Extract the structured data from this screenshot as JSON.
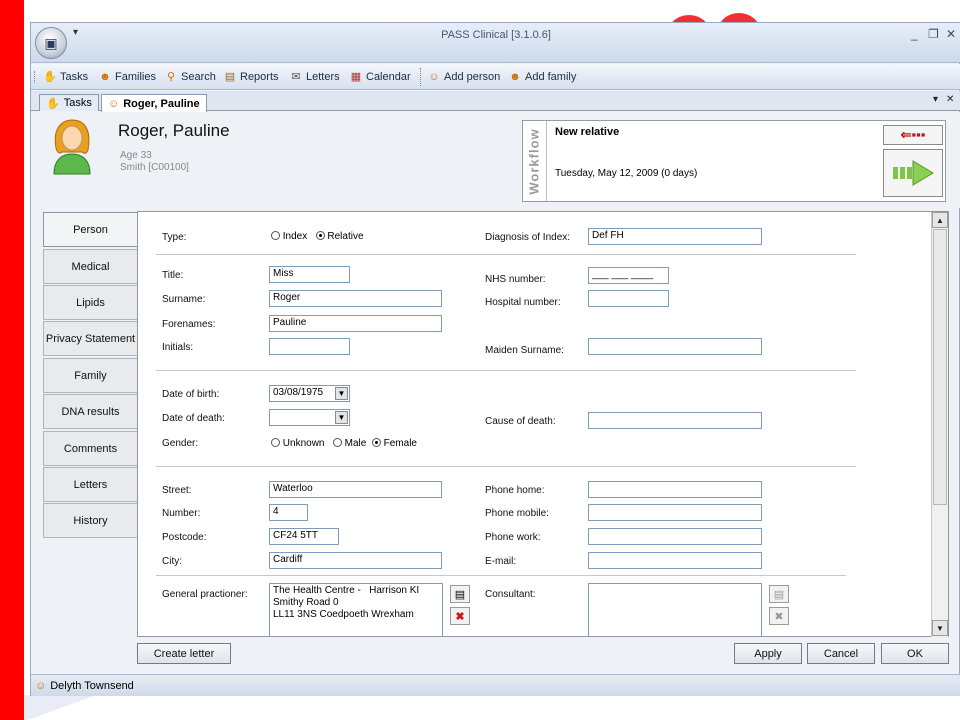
{
  "window": {
    "title": "PASS Clinical [3.1.0.6]",
    "qat_glyph": "▾",
    "min_glyph": "_",
    "restore_glyph": "❐",
    "close_glyph": "✕"
  },
  "toolbar": {
    "items": [
      {
        "label": "Tasks",
        "icon": "hand-icon"
      },
      {
        "label": "Families",
        "icon": "families-icon"
      },
      {
        "label": "Search",
        "icon": "search-icon"
      },
      {
        "label": "Reports",
        "icon": "reports-icon"
      },
      {
        "label": "Letters",
        "icon": "letters-icon"
      },
      {
        "label": "Calendar",
        "icon": "calendar-icon"
      }
    ],
    "add_items": [
      {
        "label": "Add person",
        "icon": "add-person-icon"
      },
      {
        "label": "Add family",
        "icon": "add-family-icon"
      }
    ]
  },
  "tabs": [
    {
      "label": "Tasks",
      "active": false
    },
    {
      "label": "Roger, Pauline",
      "active": true
    }
  ],
  "tab_controls": {
    "dropdown": "▾",
    "close": "✕"
  },
  "patient": {
    "name": "Roger, Pauline",
    "age": "Age 33",
    "family": "Smith [C00100]"
  },
  "workflow": {
    "label": "Workflow",
    "step": "New relative",
    "date": "Tuesday, May 12, 2009 (0 days)",
    "back_glyph": "⇐▪▪▪"
  },
  "nav": {
    "items": [
      "Person",
      "Medical",
      "Lipids",
      "Privacy Statement",
      "Family",
      "DNA results",
      "Comments",
      "Letters",
      "History"
    ],
    "active": "Person"
  },
  "form": {
    "type": {
      "label": "Type:",
      "options": [
        "Index",
        "Relative"
      ],
      "selected": "Relative"
    },
    "diagnosis": {
      "label": "Diagnosis of Index:",
      "value": "Def FH"
    },
    "title": {
      "label": "Title:",
      "value": "Miss"
    },
    "surname": {
      "label": "Surname:",
      "value": "Roger"
    },
    "forenames": {
      "label": "Forenames:",
      "value": "Pauline"
    },
    "initials": {
      "label": "Initials:",
      "value": ""
    },
    "nhs_number": {
      "label": "NHS number:",
      "value": "___ ___ ____"
    },
    "hospital_number": {
      "label": "Hospital number:",
      "value": ""
    },
    "maiden_surname": {
      "label": "Maiden Surname:",
      "value": ""
    },
    "dob": {
      "label": "Date of birth:",
      "value": "03/08/1975"
    },
    "dod": {
      "label": "Date of death:",
      "value": ""
    },
    "cause_of_death": {
      "label": "Cause of death:",
      "value": ""
    },
    "gender": {
      "label": "Gender:",
      "options": [
        "Unknown",
        "Male",
        "Female"
      ],
      "selected": "Female"
    },
    "street": {
      "label": "Street:",
      "value": "Waterloo"
    },
    "number": {
      "label": "Number:",
      "value": "4"
    },
    "postcode": {
      "label": "Postcode:",
      "value": "CF24 5TT"
    },
    "city": {
      "label": "City:",
      "value": "Cardiff"
    },
    "phone_home": {
      "label": "Phone home:",
      "value": ""
    },
    "phone_mobile": {
      "label": "Phone mobile:",
      "value": ""
    },
    "phone_work": {
      "label": "Phone work:",
      "value": ""
    },
    "email": {
      "label": "E-mail:",
      "value": ""
    },
    "gp": {
      "label": "General practioner:",
      "value": "The Health Centre -   Harrison KI\nSmithy Road 0\nLL11 3NS Coedpoeth Wrexham"
    },
    "consultant": {
      "label": "Consultant:",
      "value": ""
    }
  },
  "buttons": {
    "create_letter": "Create letter",
    "apply": "Apply",
    "cancel": "Cancel",
    "ok": "OK"
  },
  "status": {
    "user": "Delyth Townsend"
  },
  "colors": {
    "accent_red": "#ff0000",
    "toolbar_blue": "#d6e0ee"
  }
}
